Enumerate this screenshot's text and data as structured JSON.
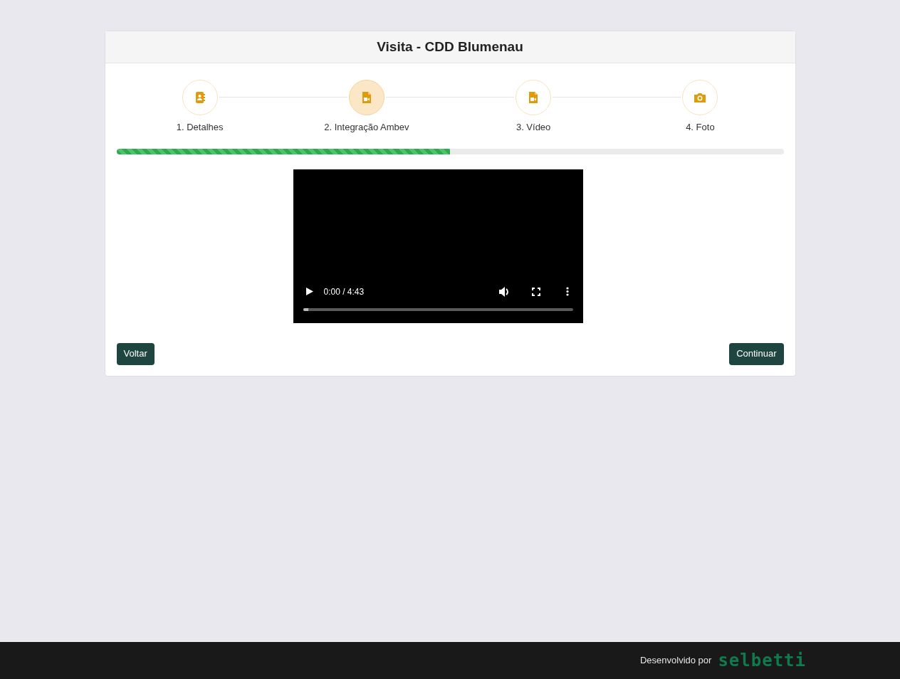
{
  "card": {
    "title": "Visita - CDD Blumenau"
  },
  "steps": [
    {
      "label": "1. Detalhes",
      "kind": "contact",
      "selected": false
    },
    {
      "label": "2. Integração Ambev",
      "kind": "video",
      "selected": true
    },
    {
      "label": "3. Vídeo",
      "kind": "video",
      "selected": false
    },
    {
      "label": "4. Foto",
      "kind": "camera",
      "selected": false
    }
  ],
  "progress": {
    "level": 0.5
  },
  "video": {
    "time": "0:00 / 4:43",
    "level": 0.02
  },
  "buttons": {
    "back": "Voltar",
    "next": "Continuar"
  },
  "footer": {
    "text": "Desenvolvido por",
    "logo": "selbetti"
  }
}
